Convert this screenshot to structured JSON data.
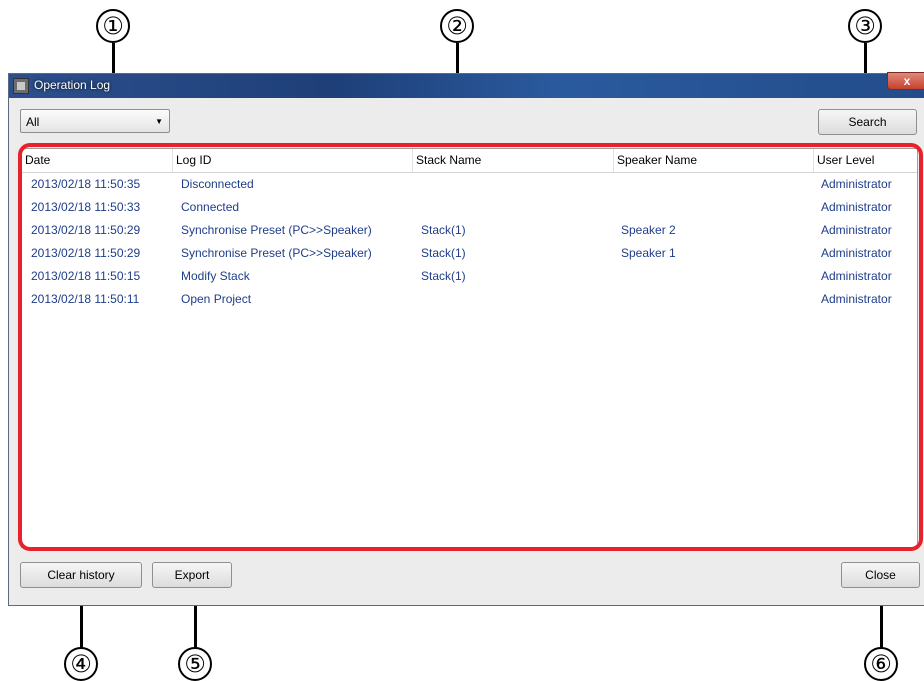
{
  "window": {
    "title": "Operation Log",
    "close_label": "x"
  },
  "filter": {
    "selected": "All",
    "caret_icon": "dropdown-arrow"
  },
  "buttons": {
    "search": "Search",
    "clear_history": "Clear history",
    "export": "Export",
    "close": "Close"
  },
  "columns": [
    "Date",
    "Log ID",
    "Stack Name",
    "Speaker Name",
    "User Level"
  ],
  "rows": [
    {
      "date": "2013/02/18 11:50:35",
      "log_id": "Disconnected",
      "stack": "",
      "speaker": "",
      "level": "Administrator"
    },
    {
      "date": "2013/02/18 11:50:33",
      "log_id": "Connected",
      "stack": "",
      "speaker": "",
      "level": "Administrator"
    },
    {
      "date": "2013/02/18 11:50:29",
      "log_id": "Synchronise Preset (PC>>Speaker)",
      "stack": "Stack(1)",
      "speaker": "Speaker 2",
      "level": "Administrator"
    },
    {
      "date": "2013/02/18 11:50:29",
      "log_id": "Synchronise Preset (PC>>Speaker)",
      "stack": "Stack(1)",
      "speaker": "Speaker 1",
      "level": "Administrator"
    },
    {
      "date": "2013/02/18 11:50:15",
      "log_id": "Modify Stack",
      "stack": "Stack(1)",
      "speaker": "",
      "level": "Administrator"
    },
    {
      "date": "2013/02/18 11:50:11",
      "log_id": "Open Project",
      "stack": "",
      "speaker": "",
      "level": "Administrator"
    }
  ],
  "callouts": [
    "①",
    "②",
    "③",
    "④",
    "⑤",
    "⑥"
  ],
  "colors": {
    "highlight": "#e8222a",
    "row_text": "#1f3d8a",
    "title_bar": "#2c4f8d"
  }
}
